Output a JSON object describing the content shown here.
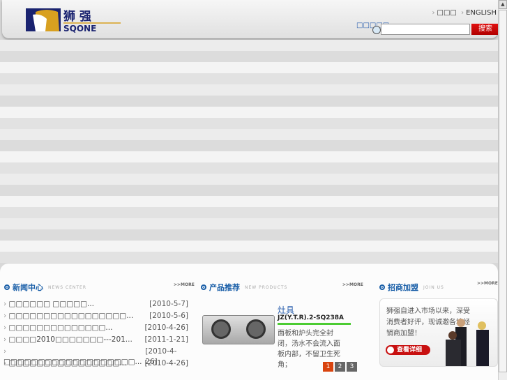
{
  "header": {
    "brand_cn": "狮强",
    "brand_en": "SQONE",
    "lang_cn": "□□□",
    "lang_en": "ENGLISH",
    "search_label": "□□□□□",
    "search_placeholder": "",
    "search_button": "搜索"
  },
  "news": {
    "title": "新闻中心",
    "subtitle": "NEWS CENTER",
    "more": ">>MORE",
    "items": [
      {
        "title": "□□□□□□ □□□□□...",
        "date": "[2010-5-7]"
      },
      {
        "title": "□□□□□□□□□□□□□□□□□...",
        "date": "[2010-5-6]"
      },
      {
        "title": "□□□□□□□□□□□□□□...",
        "date": "[2010-4-26]"
      },
      {
        "title": "□□□□2010□□□□□□□---201...",
        "date": "[2011-1-21]"
      },
      {
        "title": "□□□□□□□□□□□□□□□□□□□...",
        "date": "[2010-4-26]"
      },
      {
        "title": "□□□□□□□□□□□□□□□□...",
        "date": "[2010-4-26]"
      }
    ]
  },
  "products": {
    "title": "产品推荐",
    "subtitle": "NEW PRODUCTS",
    "more": ">>MORE",
    "category": "灶具",
    "model": "JZ(Y.T.R).2-SQ238A",
    "description": "面板和炉头完全封闭，汤水不会流入面板内部，不留卫生死角；",
    "pages": [
      "1",
      "2",
      "3"
    ],
    "active_page": "1"
  },
  "join": {
    "title": "招商加盟",
    "subtitle": "JOIN US",
    "more": ">>MORE",
    "text": "狮强自进入市场以来，深受消费者好评，现诚邀各地经销商加盟！",
    "button": "查看详细"
  },
  "colors": {
    "accent": "#1a5fa8",
    "search_button": "#c81010",
    "pager_active": "#d9440f"
  }
}
